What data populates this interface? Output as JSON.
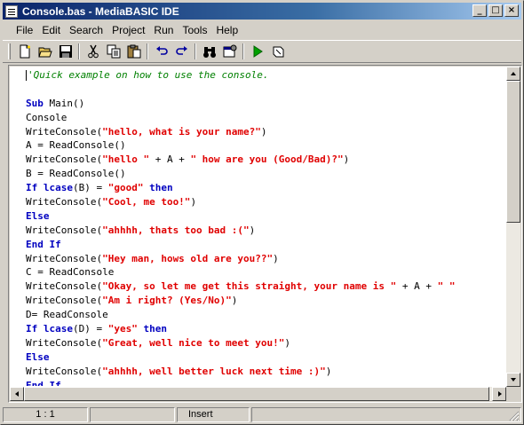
{
  "window": {
    "title": "Console.bas - MediaBASIC IDE",
    "controls": {
      "minimize": "_",
      "maximize": "□",
      "close": "×"
    }
  },
  "menu": [
    "File",
    "Edit",
    "Search",
    "Project",
    "Run",
    "Tools",
    "Help"
  ],
  "toolbar": {
    "icons": [
      "new-file-icon",
      "open-folder-icon",
      "save-disk-icon",
      "cut-icon",
      "copy-icon",
      "paste-icon",
      "undo-icon",
      "redo-icon",
      "find-binoculars-icon",
      "properties-icon",
      "run-play-icon",
      "stop-icon"
    ]
  },
  "editor": {
    "lines": [
      [
        {
          "t": "c",
          "v": "'Quick example on how to use the console."
        }
      ],
      [],
      [
        {
          "t": "k",
          "v": "Sub"
        },
        {
          "t": "n",
          "v": " Main()"
        }
      ],
      [
        {
          "t": "n",
          "v": "Console"
        }
      ],
      [
        {
          "t": "n",
          "v": "WriteConsole("
        },
        {
          "t": "s",
          "v": "\"hello, what is your name?\""
        },
        {
          "t": "n",
          "v": ")"
        }
      ],
      [
        {
          "t": "n",
          "v": "A = ReadConsole()"
        }
      ],
      [
        {
          "t": "n",
          "v": "WriteConsole("
        },
        {
          "t": "s",
          "v": "\"hello \""
        },
        {
          "t": "n",
          "v": " + A + "
        },
        {
          "t": "s",
          "v": "\" how are you (Good/Bad)?\""
        },
        {
          "t": "n",
          "v": ")"
        }
      ],
      [
        {
          "t": "n",
          "v": "B = ReadConsole()"
        }
      ],
      [
        {
          "t": "k",
          "v": "If lcase"
        },
        {
          "t": "n",
          "v": "(B) = "
        },
        {
          "t": "s",
          "v": "\"good\""
        },
        {
          "t": "n",
          "v": " "
        },
        {
          "t": "k",
          "v": "then"
        }
      ],
      [
        {
          "t": "n",
          "v": "WriteConsole("
        },
        {
          "t": "s",
          "v": "\"Cool, me too!\""
        },
        {
          "t": "n",
          "v": ")"
        }
      ],
      [
        {
          "t": "k",
          "v": "Else"
        }
      ],
      [
        {
          "t": "n",
          "v": "WriteConsole("
        },
        {
          "t": "s",
          "v": "\"ahhhh, thats too bad :(\""
        },
        {
          "t": "n",
          "v": ")"
        }
      ],
      [
        {
          "t": "k",
          "v": "End If"
        }
      ],
      [
        {
          "t": "n",
          "v": "WriteConsole("
        },
        {
          "t": "s",
          "v": "\"Hey man, hows old are you??\""
        },
        {
          "t": "n",
          "v": ")"
        }
      ],
      [
        {
          "t": "n",
          "v": "C = ReadConsole"
        }
      ],
      [
        {
          "t": "n",
          "v": "WriteConsole("
        },
        {
          "t": "s",
          "v": "\"Okay, so let me get this straight, your name is \""
        },
        {
          "t": "n",
          "v": " + A + "
        },
        {
          "t": "s",
          "v": "\" \""
        }
      ],
      [
        {
          "t": "n",
          "v": "WriteConsole("
        },
        {
          "t": "s",
          "v": "\"Am i right? (Yes/No)\""
        },
        {
          "t": "n",
          "v": ")"
        }
      ],
      [
        {
          "t": "n",
          "v": "D= ReadConsole"
        }
      ],
      [
        {
          "t": "k",
          "v": "If lcase"
        },
        {
          "t": "n",
          "v": "(D) = "
        },
        {
          "t": "s",
          "v": "\"yes\""
        },
        {
          "t": "n",
          "v": " "
        },
        {
          "t": "k",
          "v": "then"
        }
      ],
      [
        {
          "t": "n",
          "v": "WriteConsole("
        },
        {
          "t": "s",
          "v": "\"Great, well nice to meet you!\""
        },
        {
          "t": "n",
          "v": ")"
        }
      ],
      [
        {
          "t": "k",
          "v": "Else"
        }
      ],
      [
        {
          "t": "n",
          "v": "WriteConsole("
        },
        {
          "t": "s",
          "v": "\"ahhhh, well better luck next time :)\""
        },
        {
          "t": "n",
          "v": ")"
        }
      ],
      [
        {
          "t": "k",
          "v": "End If"
        }
      ]
    ]
  },
  "status": {
    "position": "1 : 1",
    "mode": "Insert"
  },
  "colors": {
    "keyword": "#0000c0",
    "string": "#e00000",
    "comment": "#008000",
    "titlebar": "#0a246a"
  }
}
